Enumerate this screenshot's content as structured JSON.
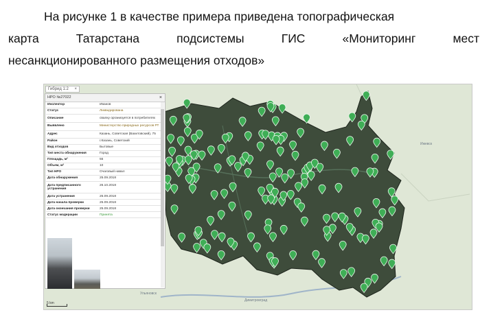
{
  "paragraph": {
    "line1": "На рисунке 1 в качестве примера приведена топографическая",
    "line2_words": [
      "карта",
      "Татарстана",
      "подсистемы",
      "ГИС",
      "«Мониторинг",
      "мест"
    ],
    "line3": "несанкционированного размещения отходов»"
  },
  "map": {
    "layer_tab": "Гибрид 1:2",
    "layer_tab_close": "×",
    "scale_label": "5 km",
    "places": [
      "Ижевск",
      "Ульяновск",
      "Димитровград"
    ],
    "colors": {
      "region_fill": "#3b4a3a",
      "surround": "#dfe7d6",
      "marker": "#3fae56"
    }
  },
  "panel": {
    "title": "НРО №27022",
    "close_label": "×",
    "rows": [
      {
        "k": "Инспектор",
        "v": "Иванов"
      },
      {
        "k": "Статус",
        "v": "Ликвидирована"
      },
      {
        "k": "Описание",
        "v": "свалку организуется в потребителях"
      },
      {
        "k": "Выявлено",
        "v": "Министерство природных ресурсов РТ"
      },
      {
        "k": "Адрес",
        "v": "Казань, Советская (Вахитовский), 75"
      },
      {
        "k": "Район",
        "v": "г.Казань, Советский"
      },
      {
        "k": "Вид отходов",
        "v": "Бытовые"
      },
      {
        "k": "Тип места обнаружения",
        "v": "Город"
      },
      {
        "k": "Площадь, м²",
        "v": "55"
      },
      {
        "k": "Объем, м³",
        "v": "10"
      },
      {
        "k": "Тип НРО",
        "v": "Очаговый навал"
      },
      {
        "k": "Дата обнаружения",
        "v": "25.09.2018"
      },
      {
        "k": "Дата предписанного устранения",
        "v": "26.10.2018"
      },
      {
        "k": "Дата устранения",
        "v": "25.09.2018"
      },
      {
        "k": "Дата начала проверки",
        "v": "25.09.2018"
      },
      {
        "k": "Дата окончания проверки",
        "v": "25.09.2018"
      },
      {
        "k": "Статус модерации",
        "v": "Принята"
      }
    ]
  }
}
